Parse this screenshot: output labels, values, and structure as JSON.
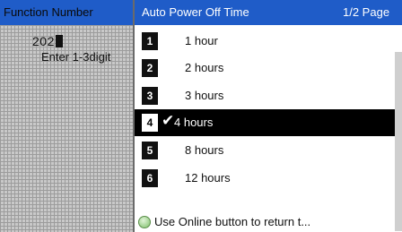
{
  "left": {
    "header": "Function Number",
    "value": "202",
    "hint": "Enter 1-3digit"
  },
  "menu": {
    "title": "Auto Power Off Time",
    "page": "1/2 Page",
    "items": [
      {
        "num": "1",
        "label": "1 hour"
      },
      {
        "num": "2",
        "label": "2 hours"
      },
      {
        "num": "3",
        "label": "3 hours"
      },
      {
        "num": "4",
        "label": "4 hours"
      },
      {
        "num": "5",
        "label": "8 hours"
      },
      {
        "num": "6",
        "label": "12 hours"
      }
    ],
    "selected_index": 3,
    "footer": "Use Online button to return t..."
  },
  "icons": {
    "selected_mark": "checkmark-icon",
    "footer": "online-button-icon"
  },
  "colors": {
    "header_bg": "#1f5cc8",
    "selected_bg": "#000000"
  }
}
